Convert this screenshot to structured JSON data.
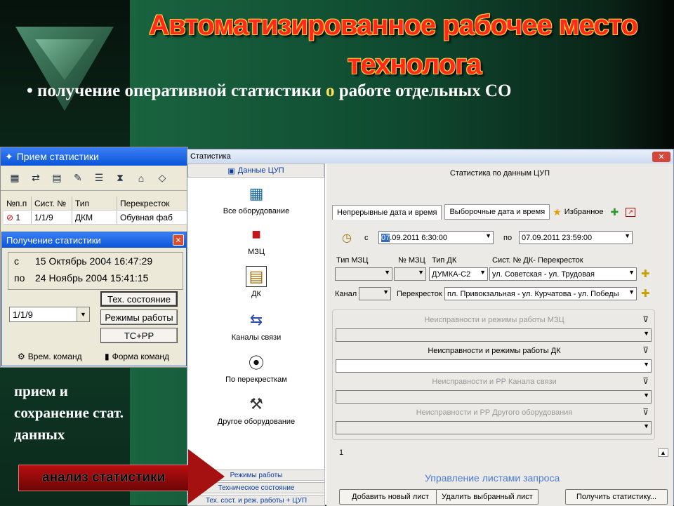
{
  "slide": {
    "title_line1": "Автоматизированное рабочее место",
    "title_line2": "технолога",
    "subtitle_bullet": "•",
    "subtitle_text1": "получение оперативной статистики ",
    "subtitle_text2": "о",
    "subtitle_text3": " работе отдельных СО",
    "left_text": [
      "прием и",
      "сохранение стат.",
      "данных"
    ],
    "arrow_label": "анализ статистики"
  },
  "win1": {
    "title": "Прием статистики",
    "columns": [
      "№п.п",
      "Сист. №",
      "Тип",
      "Перекресток"
    ],
    "row": [
      "1",
      "1/1/9",
      "ДКМ",
      "Обувная фаб"
    ]
  },
  "dlg": {
    "title": "Получение статистики",
    "from_label": "с",
    "from_value": "15 Октябрь 2004 16:47:29",
    "to_label": "по",
    "to_value": "24 Ноябрь 2004 15:41:15",
    "combo_value": "1/1/9",
    "btn_tech": "Тех. состояние",
    "btn_modes": "Режимы работы",
    "btn_tcpp": "ТС+РР",
    "foot1": "Врем. команд",
    "foot2": "Форма команд"
  },
  "win2": {
    "title": "Статистика",
    "side_header": "Данные ЦУП",
    "side_items": [
      "Все оборудование",
      "МЗЦ",
      "ДК",
      "Каналы связи",
      "По перекресткам",
      "Другое оборудование"
    ],
    "side_bottom": [
      "Режимы работы",
      "Техническое состояние",
      "Тех. сост. и реж. работы + ЦУП"
    ],
    "pane_header": "Статистика по данным ЦУП",
    "tab1": "Непрерывные дата и время",
    "tab2": "Выборочные дата и время",
    "tab3": "Избранное",
    "from_label": "с",
    "from_value_hl": "07",
    "from_value": ".09.2011 6:30:00",
    "to_label": "по",
    "to_value": "07.09.2011 23:59:00",
    "lbl_mzc_type": "Тип МЗЦ",
    "lbl_mzc_no": "№ МЗЦ",
    "lbl_dk_type": "Тип ДК",
    "lbl_sys": "Сист. № ДК- Перекресток",
    "dk_type_value": "ДУМКА-С2",
    "sys_value": "ул. Советская - ул. Трудовая",
    "lbl_channel": "Канал",
    "lbl_crossing": "Перекресток",
    "crossing_value": "пл. Привокзальная - ул. Курчатова - ул. Победы",
    "sect1": "Неисправности и режимы работы МЗЦ",
    "sect2": "Неисправности и режимы работы ДК",
    "sect3": "Неисправности и РР Канала связи",
    "sect4": "Неисправности и РР Другого оборудования",
    "page_tab": "1",
    "manage_label": "Управление листами запроса",
    "btn_add": "Добавить новый лист",
    "btn_del": "Удалить выбранный лист",
    "btn_get": "Получить статистику..."
  },
  "colors": {
    "title_red": "#ff2a1e",
    "title_outline": "#ffd23a",
    "xp_blue": "#0a55d8"
  }
}
